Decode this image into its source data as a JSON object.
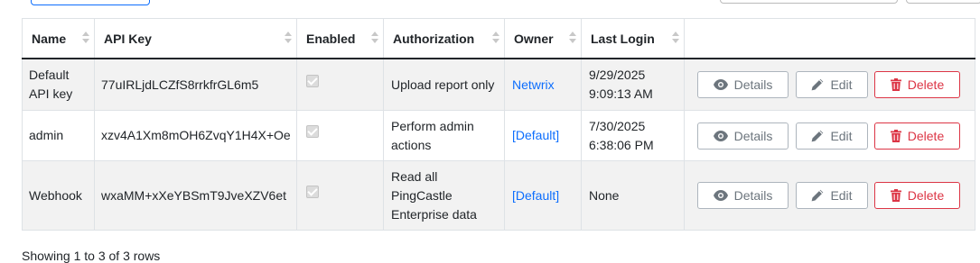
{
  "table": {
    "headers": [
      "Name",
      "API Key",
      "Enabled",
      "Authorization",
      "Owner",
      "Last Login"
    ],
    "rows": [
      {
        "name": "Default API key",
        "api_key": "77uIRLjdLCZfS8rrkfrGL6m5",
        "enabled": true,
        "authorization": "Upload report only",
        "owner": "Netwrix",
        "last_login": "9/29/2025 9:09:13 AM"
      },
      {
        "name": "admin",
        "api_key": "xzv4A1Xm8mOH6ZvqY1H4X+Oe",
        "enabled": true,
        "authorization": "Perform admin actions",
        "owner": "[Default]",
        "last_login": "7/30/2025 6:38:06 PM"
      },
      {
        "name": "Webhook",
        "api_key": "wxaMM+xXeYBSmT9JveXZV6et",
        "enabled": true,
        "authorization": "Read all PingCastle Enterprise data",
        "owner": "[Default]",
        "last_login": "None"
      }
    ]
  },
  "actions": {
    "details_label": "Details",
    "edit_label": "Edit",
    "delete_label": "Delete"
  },
  "icons": {
    "details": "eye-icon",
    "edit": "pencil-icon",
    "delete": "trash-icon"
  },
  "colors": {
    "link": "#0d6efd",
    "danger": "#dc3545",
    "muted": "#6c757d",
    "row_stripe": "#f2f2f2"
  },
  "footer": {
    "text": "Showing 1 to 3 of 3 rows"
  }
}
